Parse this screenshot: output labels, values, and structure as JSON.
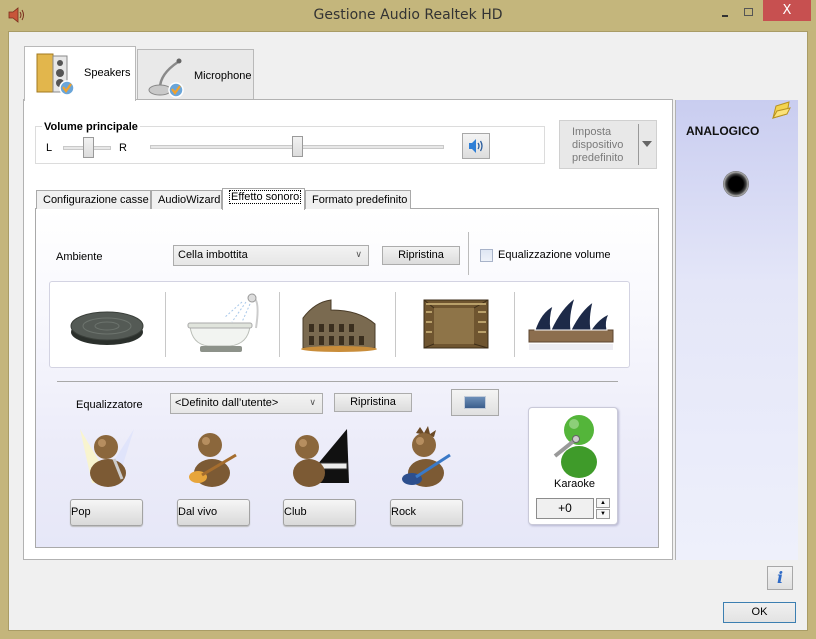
{
  "window": {
    "title": "Gestione Audio Realtek HD",
    "close_glyph": "X"
  },
  "device_tabs": [
    {
      "label": "Speakers",
      "icon": "speakers-icon",
      "selected": true
    },
    {
      "label": "Microphone",
      "icon": "microphone-icon",
      "selected": false
    }
  ],
  "volume": {
    "title": "Volume principale",
    "left_label": "L",
    "right_label": "R",
    "balance_position": 0.5,
    "master_level": 0.5,
    "mute_icon": "speaker-volume-icon"
  },
  "default_device": {
    "label": "Imposta dispositivo predefinito"
  },
  "side_panel": {
    "label": "ANALOGICO",
    "folder_icon": "folder-icon",
    "jack_icon": "audio-jack-icon"
  },
  "inner_tabs": [
    {
      "label": "Configurazione casse",
      "selected": false
    },
    {
      "label": "AudioWizard",
      "selected": false
    },
    {
      "label": "Effetto sonoro",
      "selected": true
    },
    {
      "label": "Formato predefinito",
      "selected": false
    }
  ],
  "ambient": {
    "label": "Ambiente",
    "selected": "Cella imbottita",
    "reset_label": "Ripristina",
    "eq_volume_label": "Equalizzazione volume",
    "eq_volume_checked": false,
    "environments": [
      {
        "name": "manhole-cover-icon"
      },
      {
        "name": "bathtub-icon"
      },
      {
        "name": "colosseum-icon"
      },
      {
        "name": "stone-room-icon"
      },
      {
        "name": "opera-house-icon"
      }
    ]
  },
  "equalizer": {
    "label": "Equalizzatore",
    "selected": "<Definito dall’utente>",
    "reset_label": "Ripristina",
    "presets": [
      {
        "label": "Pop",
        "icon": "pop-singer-icon"
      },
      {
        "label": "Dal vivo",
        "icon": "live-guitarist-icon"
      },
      {
        "label": "Club",
        "icon": "club-pianist-icon"
      },
      {
        "label": "Rock",
        "icon": "rock-guitarist-icon"
      }
    ]
  },
  "karaoke": {
    "label": "Karaoke",
    "value": "+0",
    "up_glyph": "▲",
    "down_glyph": "▼"
  },
  "footer": {
    "info_glyph": "i",
    "ok_label": "OK"
  },
  "colors": {
    "frame": "#c4b57c",
    "close": "#c75050",
    "side_panel": "#dfe2f6"
  }
}
